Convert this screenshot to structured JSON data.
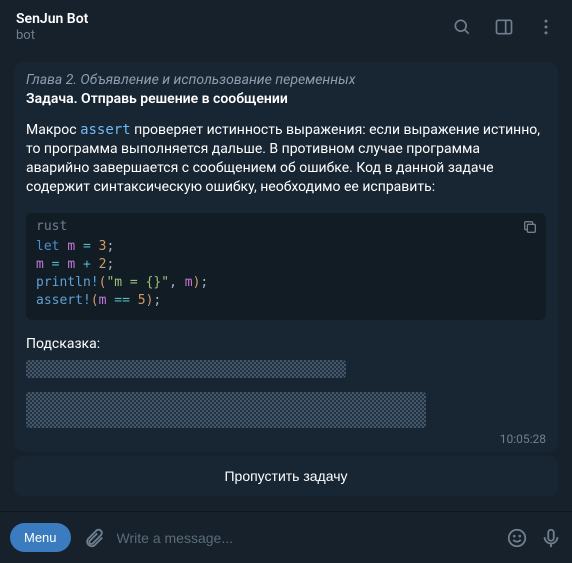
{
  "header": {
    "title": "SenJun Bot",
    "subtitle": "bot"
  },
  "message": {
    "chapter": "Глава 2. Объявление и использование переменных",
    "task_header": "Задача. Отправь решение в сообщении",
    "task_text_before": "Макрос ",
    "task_text_code": "assert",
    "task_text_after": " проверяет истинность выражения: если выражение истинно, то программа выполняется дальше. В противном случае программа аварийно завершается с сообщением об ошибке. Код в данной задаче содержит синтаксическую ошибку, необходимо ее исправить:",
    "code_lang": "rust",
    "hint_label": "Подсказка:",
    "timestamp": "10:05:28"
  },
  "code": {
    "line1": {
      "kw": "let",
      "var": "m",
      "eq": "=",
      "num": "3",
      "semi": ";"
    },
    "line2": {
      "var1": "m",
      "eq": "=",
      "var2": "m",
      "plus": "+",
      "num": "2",
      "semi": ";"
    },
    "line3": {
      "fn": "println!",
      "open": "(",
      "str": "\"m = {}\"",
      "comma": ",",
      "var": "m",
      "close": ")",
      "semi": ";"
    },
    "line4": {
      "fn": "assert!",
      "open": "(",
      "var": "m",
      "eq": "==",
      "num": "5",
      "close": ")",
      "semi": ";"
    }
  },
  "buttons": {
    "skip": "Пропустить задачу",
    "menu": "Menu"
  },
  "input": {
    "placeholder": "Write a message..."
  }
}
